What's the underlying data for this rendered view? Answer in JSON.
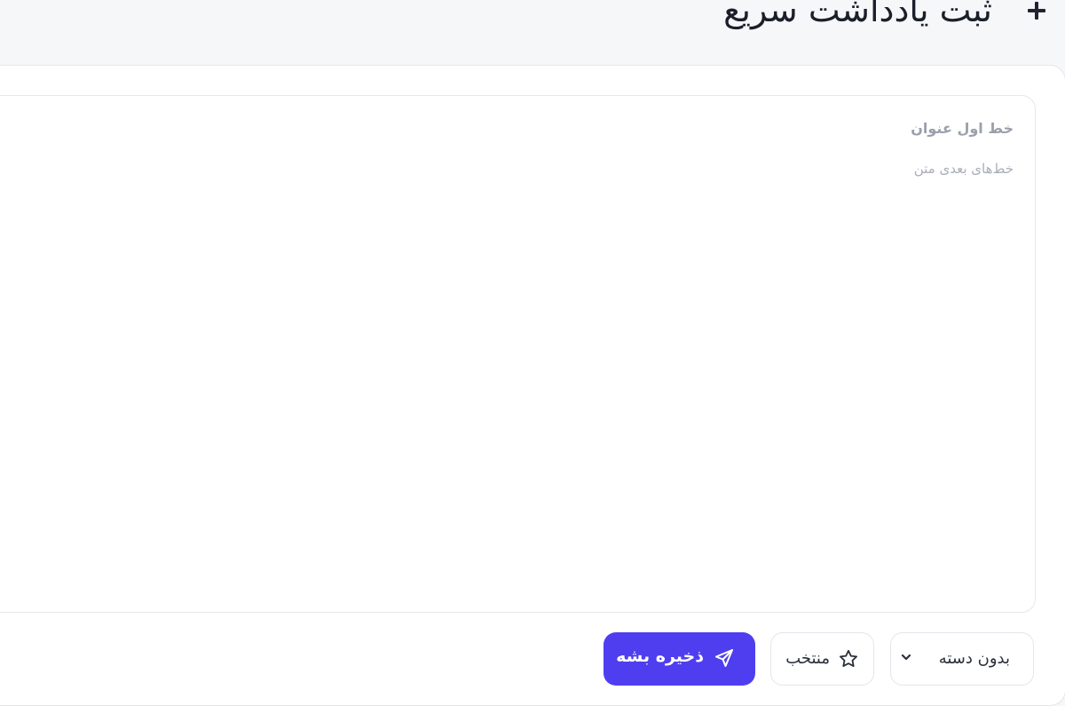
{
  "header": {
    "title": "ثبت یادداشت سریع",
    "add_icon": "plus-icon"
  },
  "editor": {
    "title_placeholder": "خط اول عنوان",
    "body_placeholder": "خط‌های بعدی متن"
  },
  "toolbar": {
    "category": {
      "selected": "بدون دسته",
      "icon": "chevron-down-icon"
    },
    "favorite": {
      "label": "منتخب",
      "icon": "star-icon"
    },
    "save": {
      "label": "ذخیره بشه",
      "icon": "send-icon"
    }
  },
  "colors": {
    "accent": "#4f3ef0",
    "background": "#f6f7f9",
    "card": "#ffffff",
    "border": "#e3e6ec",
    "placeholder": "#9aa0ab"
  }
}
